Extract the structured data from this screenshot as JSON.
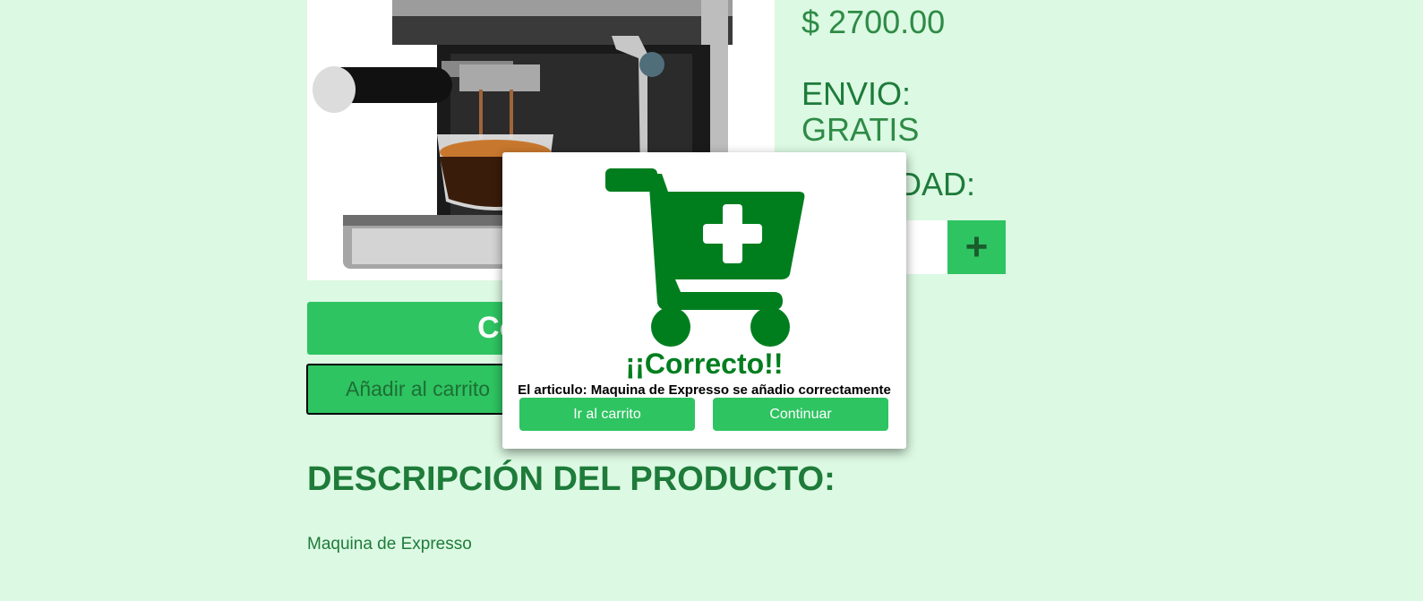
{
  "product": {
    "price": "$ 2700.00",
    "shipping_label": "ENVIO:",
    "shipping_value": "GRATIS",
    "quantity_label": "CANTIDAD:",
    "quantity_plus": "+",
    "buy_label": "Comprar",
    "add_to_cart_label": "Añadir al carrito",
    "description_title": "DESCRIPCIÓN DEL PRODUCTO:",
    "description_text": "Maquina de Expresso"
  },
  "modal": {
    "title": "¡¡Correcto!!",
    "message": "El articulo: Maquina de Expresso se añadio correctamente",
    "go_to_cart_label": "Ir al carrito",
    "continue_label": "Continuar",
    "icon": "cart-plus-icon"
  },
  "colors": {
    "background": "#dcf9e3",
    "accent": "#2ec461",
    "dark_green": "#007e1e",
    "text_green": "#1e7b3a"
  }
}
